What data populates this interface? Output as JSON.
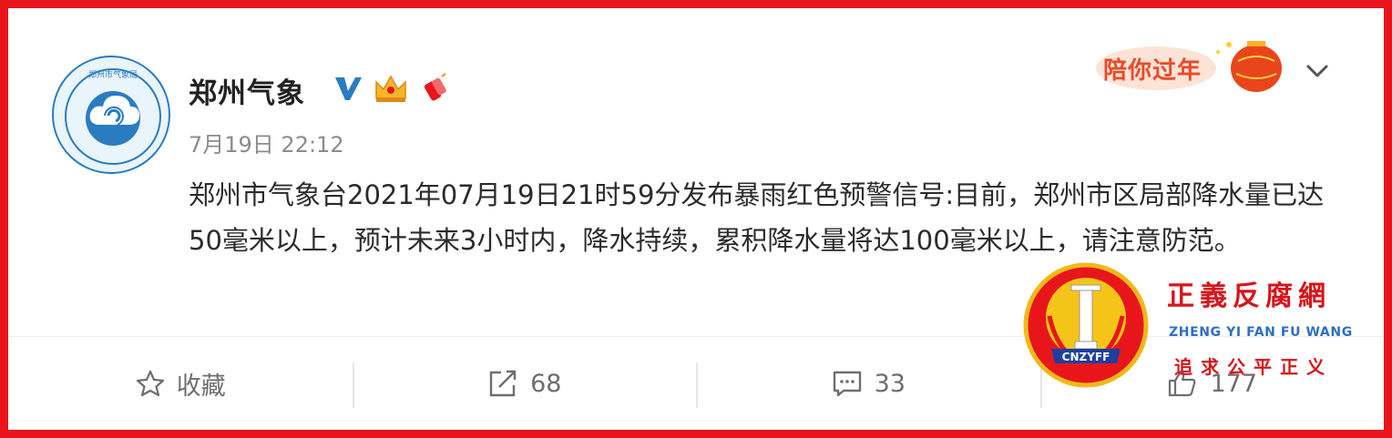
{
  "post": {
    "username": "郑州气象",
    "timestamp": "7月19日 22:12",
    "text": "郑州市气象台2021年07月19日21时59分发布暴雨红色预警信号:目前，郑州市区局部降水量已达50毫米以上，预计未来3小时内，降水持续，累积降水量将达100毫米以上，请注意防范。",
    "badges": [
      "verified-v-icon",
      "crown-badge-icon",
      "firecracker-badge-icon"
    ]
  },
  "promo": {
    "label": "陪你过年"
  },
  "actions": {
    "favorite_label": "收藏",
    "repost_count": "68",
    "comment_count": "33",
    "like_count": "177"
  },
  "watermark": {
    "site_name": "正義反腐網",
    "pinyin": "ZHENG YI FAN FU WANG",
    "slogan": "追求公平正义",
    "logo_text": "CNZYFF"
  },
  "colors": {
    "border": "#e8161a",
    "verified": "#2a7cc1",
    "text": "#2b2b2b",
    "muted": "#8b8b8b"
  }
}
